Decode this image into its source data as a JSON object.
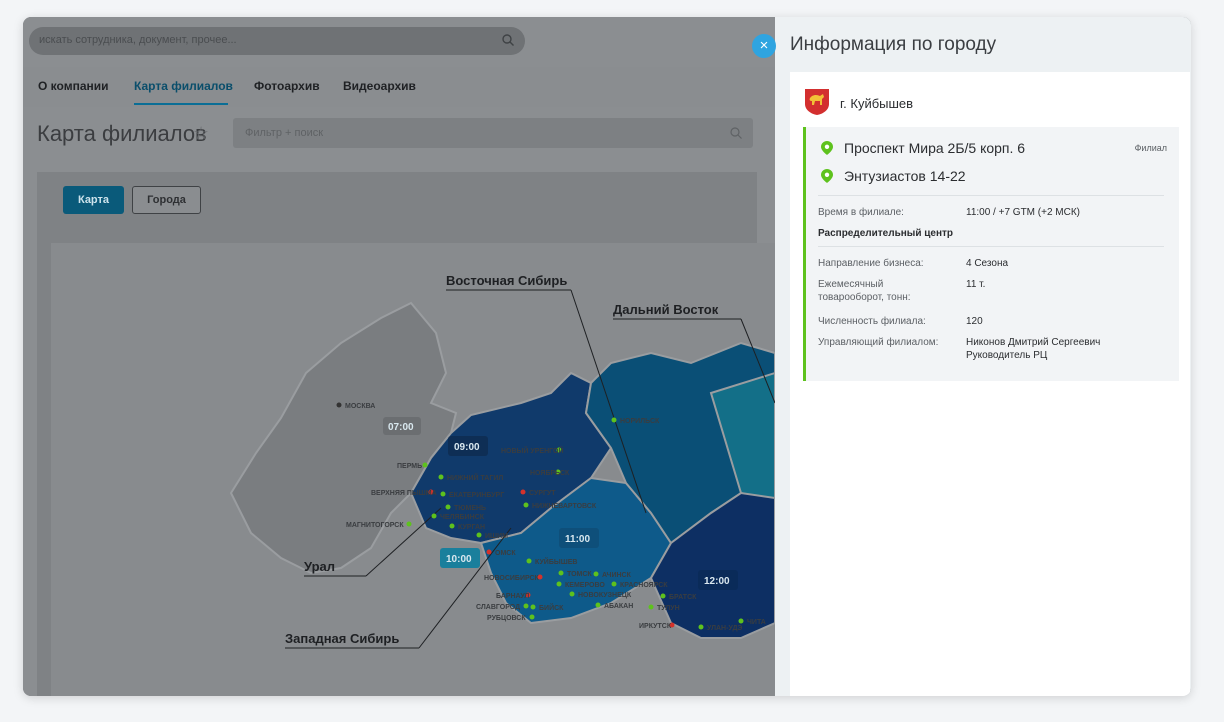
{
  "search": {
    "placeholder": "искать сотрудника, документ, прочее..."
  },
  "nav": {
    "tabs": [
      "О компании",
      "Карта филиалов",
      "Фотоархив",
      "Видеоархив"
    ],
    "active": "Карта филиалов"
  },
  "page": {
    "title": "Карта филиалов",
    "filter_placeholder": "Фильтр + поиск"
  },
  "view_buttons": {
    "map": "Карта",
    "cities": "Города"
  },
  "map": {
    "regions": [
      "Восточная Сибирь",
      "Дальний Восток",
      "Урал",
      "Западная Сибирь"
    ],
    "timezones": [
      "07:00",
      "09:00",
      "10:00",
      "11:00",
      "12:00"
    ],
    "cities": [
      "МОСКВА",
      "НОРИЛЬСК",
      "НОВЫЙ УРЕНГОЙ",
      "ПЕРМЬ",
      "НИЖНИЙ ТАГИЛ",
      "НОЯБРЬСК",
      "ВЕРХНЯЯ ПЫШМА",
      "ЕКАТЕРИНБУРГ",
      "СУРГУТ",
      "ТЮМЕНЬ",
      "НИЖНЕВАРТОВСК",
      "ЧЕЛЯБИНСК",
      "МАГНИТОГОРСК",
      "КУРГАН",
      "ИШИМ",
      "ОМСК",
      "КУЙБЫШЕВ",
      "ТОМСК",
      "АЧИНСК",
      "НОВОСИБИРСК",
      "КЕМЕРОВО",
      "КРАСНОЯРСК",
      "БАРНАУЛ",
      "НОВОКУЗНЕЦК",
      "БРАТСК",
      "СЛАВГОРОД",
      "БИЙСК",
      "АБАКАН",
      "ТУЛУН",
      "РУБЦОВСК",
      "ИРКУТСК",
      "УЛАН-УДЭ",
      "ЧИТА"
    ]
  },
  "side": {
    "title": "Информация по городу",
    "close": "×",
    "city": "г. Куйбышев",
    "addresses": [
      "Проспект Мира 2Б/5 корп. 6",
      "Энтузиастов 14-22"
    ],
    "branch_tag": "Филиал",
    "time_label": "Время в филиале:",
    "time_value": "11:00 / +7 GTM (+2 МСК)",
    "center": "Распределительный центр",
    "fields": [
      {
        "label": "Направление бизнеса:",
        "value": "4 Сезона"
      },
      {
        "label": "Ежемесячный товарооборот, тонн:",
        "value": "11 т."
      },
      {
        "label": "Численность филиала:",
        "value": "120"
      },
      {
        "label": "Управляющий филиалом:",
        "value": "Никонов Дмитрий Сергеевич Руководитель РЦ"
      }
    ]
  },
  "colors": {
    "accent": "#2fa4e0",
    "active_tab": "#0a6e96",
    "branch_border": "#5ec21d",
    "pin": "#5ec21d"
  }
}
